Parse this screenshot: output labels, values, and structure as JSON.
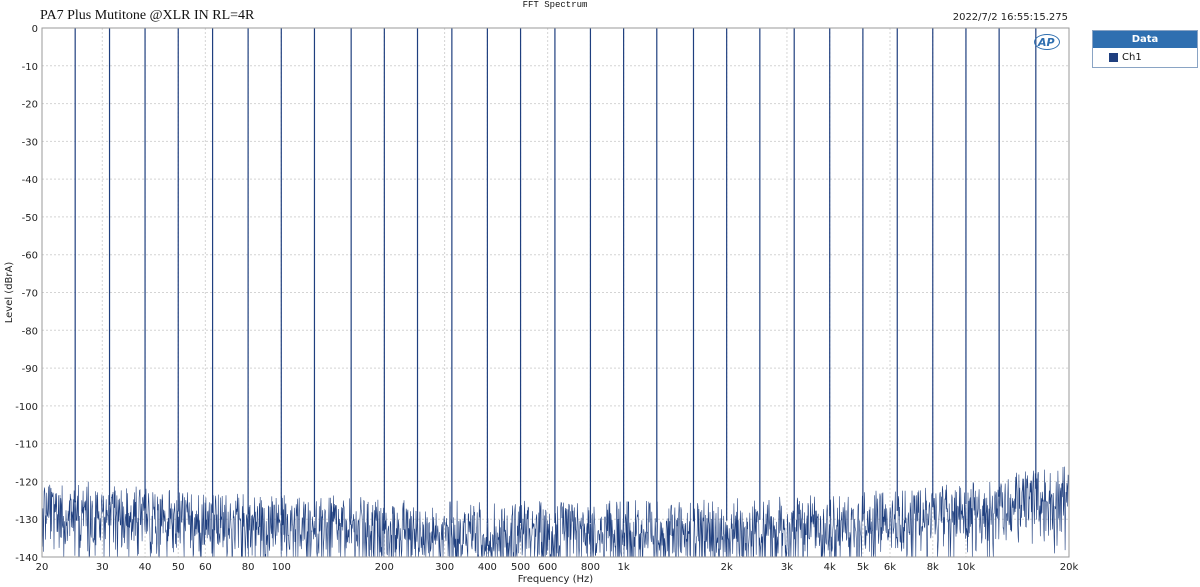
{
  "header": {
    "title": "PA7 Plus Mutitone @XLR IN  RL=4R",
    "center_label": "FFT Spectrum",
    "timestamp": "2022/7/2 16:55:15.275"
  },
  "legend": {
    "title": "Data",
    "items": [
      {
        "label": "Ch1",
        "color": "#1f3f7f"
      }
    ]
  },
  "logo": {
    "text": "AP"
  },
  "chart_data": {
    "type": "line",
    "title": "FFT Spectrum",
    "xlabel": "Frequency (Hz)",
    "ylabel": "Level (dBrA)",
    "xscale": "log",
    "xlim": [
      20,
      20000
    ],
    "ylim": [
      -140,
      0
    ],
    "grid": true,
    "legend_position": "right-outside",
    "x_ticks": [
      20,
      30,
      40,
      50,
      60,
      80,
      100,
      200,
      300,
      400,
      500,
      600,
      800,
      1000,
      2000,
      3000,
      4000,
      5000,
      6000,
      8000,
      10000,
      20000
    ],
    "x_tick_labels": [
      "20",
      "30",
      "40",
      "50",
      "60",
      "80",
      "100",
      "200",
      "300",
      "400",
      "500",
      "600",
      "800",
      "1k",
      "2k",
      "3k",
      "4k",
      "5k",
      "6k",
      "8k",
      "10k",
      "20k"
    ],
    "y_ticks": [
      0,
      -10,
      -20,
      -30,
      -40,
      -50,
      -60,
      -70,
      -80,
      -90,
      -100,
      -110,
      -120,
      -130,
      -140
    ],
    "y_tick_labels": [
      "0",
      "-10",
      "-20",
      "-30",
      "-40",
      "-50",
      "-60",
      "-70",
      "-80",
      "-90",
      "-100",
      "-110",
      "-120",
      "-130",
      "-140"
    ],
    "series": [
      {
        "name": "Ch1",
        "color": "#1f3f7f",
        "tone_frequencies_hz": [
          25,
          31.5,
          40,
          50,
          63,
          80,
          100,
          125,
          160,
          200,
          250,
          315,
          400,
          500,
          630,
          800,
          1000,
          1250,
          1600,
          2000,
          2500,
          3150,
          4000,
          5000,
          6300,
          8000,
          10000,
          12500,
          16000
        ],
        "tone_level_dbra": 0,
        "noise_floor_dbra": [
          {
            "freq": 20,
            "level": -125
          },
          {
            "freq": 30,
            "level": -126
          },
          {
            "freq": 50,
            "level": -128
          },
          {
            "freq": 100,
            "level": -129
          },
          {
            "freq": 300,
            "level": -131
          },
          {
            "freq": 1000,
            "level": -131
          },
          {
            "freq": 3000,
            "level": -130
          },
          {
            "freq": 6000,
            "level": -128
          },
          {
            "freq": 10000,
            "level": -126
          },
          {
            "freq": 20000,
            "level": -120
          }
        ]
      }
    ]
  }
}
